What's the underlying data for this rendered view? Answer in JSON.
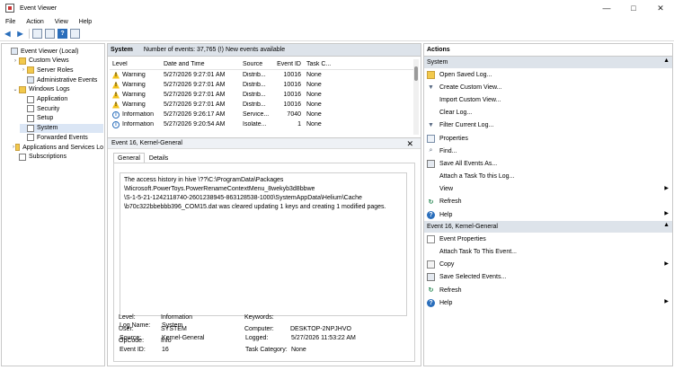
{
  "window": {
    "title": "Event Viewer",
    "controls": [
      "—",
      "□",
      "✕"
    ]
  },
  "menu": [
    "File",
    "Action",
    "View",
    "Help"
  ],
  "tree": [
    {
      "label": "Event Viewer (Local)",
      "level": 0,
      "chev": "",
      "icon": "monitor"
    },
    {
      "label": "Custom Views",
      "level": 1,
      "chev": "›",
      "icon": "folder"
    },
    {
      "label": "Server Roles",
      "level": 2,
      "chev": "›",
      "icon": "folder"
    },
    {
      "label": "Administrative Events",
      "level": 2,
      "chev": "",
      "icon": "filter"
    },
    {
      "label": "Windows Logs",
      "level": 1,
      "chev": "⌄",
      "icon": "folder"
    },
    {
      "label": "Application",
      "level": 2,
      "chev": "",
      "icon": "log"
    },
    {
      "label": "Security",
      "level": 2,
      "chev": "",
      "icon": "log"
    },
    {
      "label": "Setup",
      "level": 2,
      "chev": "",
      "icon": "log"
    },
    {
      "label": "System",
      "level": 2,
      "chev": "",
      "icon": "log",
      "selected": true
    },
    {
      "label": "Forwarded Events",
      "level": 2,
      "chev": "",
      "icon": "log"
    },
    {
      "label": "Applications and Services Lo",
      "level": 1,
      "chev": "›",
      "icon": "folder"
    },
    {
      "label": "Subscriptions",
      "level": 1,
      "chev": "",
      "icon": "log"
    }
  ],
  "center": {
    "log_name": "System",
    "summary": "Number of events: 37,765 (!) New events available",
    "columns": [
      "Level",
      "Date and Time",
      "Source",
      "Event ID",
      "Task C..."
    ],
    "rows": [
      {
        "level": "Warning",
        "date": "5/27/2026 9:27:01 AM",
        "source": "Distrib...",
        "event_id": "10016",
        "task": "None"
      },
      {
        "level": "Warning",
        "date": "5/27/2026 9:27:01 AM",
        "source": "Distrib...",
        "event_id": "10016",
        "task": "None"
      },
      {
        "level": "Warning",
        "date": "5/27/2026 9:27:01 AM",
        "source": "Distrib...",
        "event_id": "10016",
        "task": "None"
      },
      {
        "level": "Warning",
        "date": "5/27/2026 9:27:01 AM",
        "source": "Distrib...",
        "event_id": "10016",
        "task": "None"
      },
      {
        "level": "Information",
        "date": "5/27/2026 9:26:17 AM",
        "source": "Service...",
        "event_id": "7040",
        "task": "None"
      },
      {
        "level": "Information",
        "date": "5/27/2026 9:20:54 AM",
        "source": "Isolate...",
        "event_id": "1",
        "task": "None"
      }
    ],
    "detail_title": "Event 16, Kernel-General",
    "tabs": [
      "General",
      "Details"
    ],
    "description_lines": [
      "The access history in hive \\??\\C:\\ProgramData\\Packages",
      "\\Microsoft.PowerToys.PowerRenameContextMenu_8wekyb3d8bbwe",
      "\\S-1-5-21-1242118740-2601238945-863128538-1000\\SystemAppData\\Helium\\Cache",
      "\\b70c322bbebbb396_COM15.dat was cleared updating 1 keys and creating 1 modified pages."
    ],
    "props": {
      "log_name_label": "Log Name:",
      "log_name_value": "System",
      "source_label": "Source:",
      "source_value": "Kernel-General",
      "logged_label": "Logged:",
      "logged_value": "5/27/2026 11:53:22 AM",
      "event_id_label": "Event ID:",
      "event_id_value": "16",
      "task_cat_label": "Task Category:",
      "task_cat_value": "None",
      "level_label": "Level:",
      "level_value": "Information",
      "keywords_label": "Keywords:",
      "keywords_value": "",
      "user_label": "User:",
      "user_value": "SYSTEM",
      "computer_label": "Computer:",
      "computer_value": "DESKTOP-2NPJHVO",
      "opcode_label": "OpCode:",
      "opcode_value": "Info"
    }
  },
  "actions": {
    "title": "Actions",
    "sections": [
      {
        "heading": "System",
        "items": [
          {
            "label": "Open Saved Log...",
            "icon": "folder"
          },
          {
            "label": "Create Custom View...",
            "icon": "filter"
          },
          {
            "label": "Import Custom View...",
            "icon": "blank"
          },
          {
            "label": "Clear Log...",
            "icon": "blank"
          },
          {
            "label": "Filter Current Log...",
            "icon": "filter"
          },
          {
            "label": "Properties",
            "icon": "props"
          },
          {
            "label": "Find...",
            "icon": "find"
          },
          {
            "label": "Save All Events As...",
            "icon": "save"
          },
          {
            "label": "Attach a Task To this Log...",
            "icon": "blank"
          },
          {
            "label": "View",
            "icon": "blank",
            "submenu": true
          },
          {
            "label": "Refresh",
            "icon": "refresh"
          },
          {
            "label": "Help",
            "icon": "help",
            "submenu": true
          }
        ]
      },
      {
        "heading": "Event 16, Kernel-General",
        "items": [
          {
            "label": "Event Properties",
            "icon": "doc"
          },
          {
            "label": "Attach Task To This Event...",
            "icon": "blank"
          },
          {
            "label": "Copy",
            "icon": "copy",
            "submenu": true
          },
          {
            "label": "Save Selected Events...",
            "icon": "save"
          },
          {
            "label": "Refresh",
            "icon": "refresh"
          },
          {
            "label": "Help",
            "icon": "help",
            "submenu": true
          }
        ]
      }
    ]
  }
}
